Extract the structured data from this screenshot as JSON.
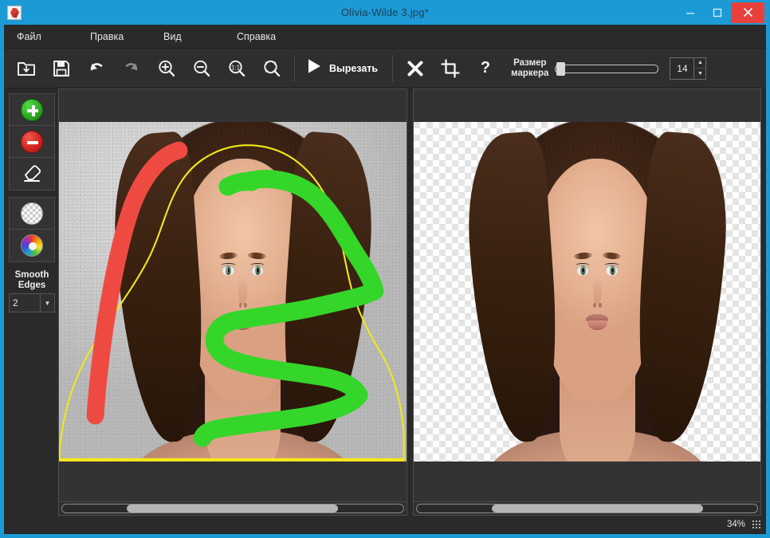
{
  "window": {
    "title": "Olivia-Wilde 3.jpg*",
    "app_icon": "app-logo-icon",
    "accent_color": "#1c9ad6",
    "chrome_color": "#2a2a2a",
    "close_color": "#e8413c",
    "buttons": {
      "minimize": "minimize-icon",
      "maximize": "maximize-icon",
      "close": "close-icon"
    }
  },
  "menu": {
    "items": [
      {
        "label": "Файл",
        "name": "menu-file"
      },
      {
        "label": "Правка",
        "name": "menu-edit"
      },
      {
        "label": "Вид",
        "name": "menu-view"
      },
      {
        "label": "Справка",
        "name": "menu-help"
      }
    ]
  },
  "toolbar": {
    "open_icon": "open-folder-icon",
    "save_icon": "save-disk-icon",
    "undo_icon": "undo-arrow-icon",
    "redo_icon": "redo-arrow-icon",
    "zoom_in_icon": "zoom-in-icon",
    "zoom_out_icon": "zoom-out-icon",
    "zoom_actual_icon": "zoom-1to1-icon",
    "zoom_fit_icon": "zoom-fit-icon",
    "cut_icon": "play-triangle-icon",
    "cut_label": "Вырезать",
    "clear_icon": "cross-x-icon",
    "crop_icon": "crop-icon",
    "help_icon": "question-mark-icon",
    "marker_size_label": "Размер\nмаркера",
    "marker_size_value": "14",
    "spin_up_icon": "spin-up-arrow-icon",
    "spin_down_icon": "spin-down-arrow-icon"
  },
  "rail": {
    "keep_icon": "green-plus-icon",
    "remove_icon": "red-minus-icon",
    "eraser_icon": "eraser-icon",
    "transparency_icon": "checkerboard-circle-icon",
    "color_icon": "color-wheel-icon",
    "smooth_edges_label": "Smooth\nEdges",
    "smooth_edges_value": "2",
    "smooth_edges_arrow": "chevron-down-icon"
  },
  "panels": {
    "source": {
      "name": "source-image-panel",
      "marker_green": "#35d62a",
      "marker_red": "#ef4a42",
      "selection_outline": "#f5e71a",
      "scroll_thumb_left_pct": 19,
      "scroll_thumb_width_pct": 62
    },
    "result": {
      "name": "result-preview-panel",
      "background": "transparent-checkerboard",
      "scroll_thumb_left_pct": 22,
      "scroll_thumb_width_pct": 62
    }
  },
  "statusbar": {
    "zoom_level": "34%",
    "grip_icon": "resize-grip-icon"
  }
}
